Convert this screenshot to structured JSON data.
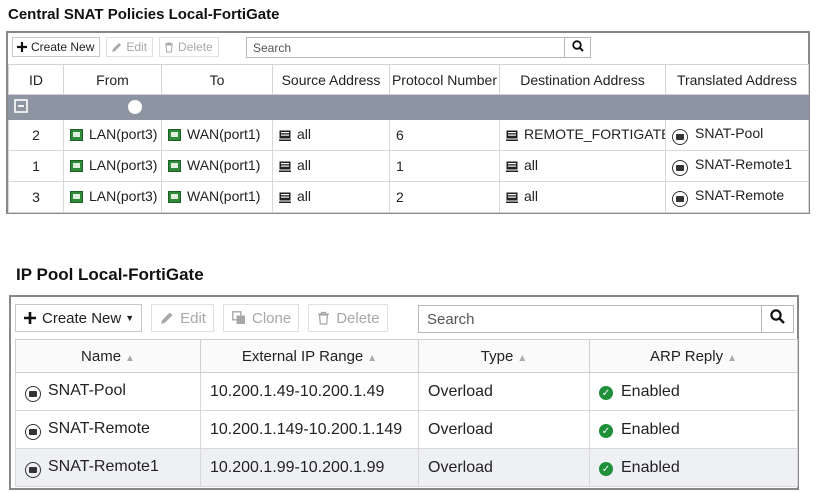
{
  "snat": {
    "title": "Central SNAT Policies Local-FortiGate",
    "toolbar": {
      "create_new": "Create New",
      "edit": "Edit",
      "delete": "Delete",
      "search_placeholder": "Search"
    },
    "columns": [
      "ID",
      "From",
      "To",
      "Source Address",
      "Protocol Number",
      "Destination Address",
      "Translated Address"
    ],
    "rows": [
      {
        "id": "2",
        "from": "LAN(port3)",
        "to": "WAN(port1)",
        "source": "all",
        "protocol": "6",
        "destination": "REMOTE_FORTIGATE",
        "translated": "SNAT-Pool"
      },
      {
        "id": "1",
        "from": "LAN(port3)",
        "to": "WAN(port1)",
        "source": "all",
        "protocol": "1",
        "destination": "all",
        "translated": "SNAT-Remote1"
      },
      {
        "id": "3",
        "from": "LAN(port3)",
        "to": "WAN(port1)",
        "source": "all",
        "protocol": "2",
        "destination": "all",
        "translated": "SNAT-Remote"
      }
    ]
  },
  "ippool": {
    "title": "IP Pool Local-FortiGate",
    "toolbar": {
      "create_new": "Create New",
      "edit": "Edit",
      "clone": "Clone",
      "delete": "Delete",
      "search_placeholder": "Search"
    },
    "columns": [
      "Name",
      "External IP Range",
      "Type",
      "ARP Reply"
    ],
    "rows": [
      {
        "name": "SNAT-Pool",
        "range": "10.200.1.49-10.200.1.49",
        "type": "Overload",
        "arp": "Enabled"
      },
      {
        "name": "SNAT-Remote",
        "range": "10.200.1.149-10.200.1.149",
        "type": "Overload",
        "arp": "Enabled"
      },
      {
        "name": "SNAT-Remote1",
        "range": "10.200.1.99-10.200.1.99",
        "type": "Overload",
        "arp": "Enabled"
      }
    ]
  },
  "colors": {
    "group_row": "#8c95a1",
    "enabled_green": "#1f8f3a",
    "interface_green": "#2f8a3a"
  },
  "icons": [
    "plus-icon",
    "pencil-icon",
    "trash-icon",
    "clone-icon",
    "search-icon",
    "collapse-icon",
    "interface-icon",
    "address-icon",
    "ip-pool-icon",
    "check-icon",
    "sort-icon",
    "caret-down-icon"
  ]
}
